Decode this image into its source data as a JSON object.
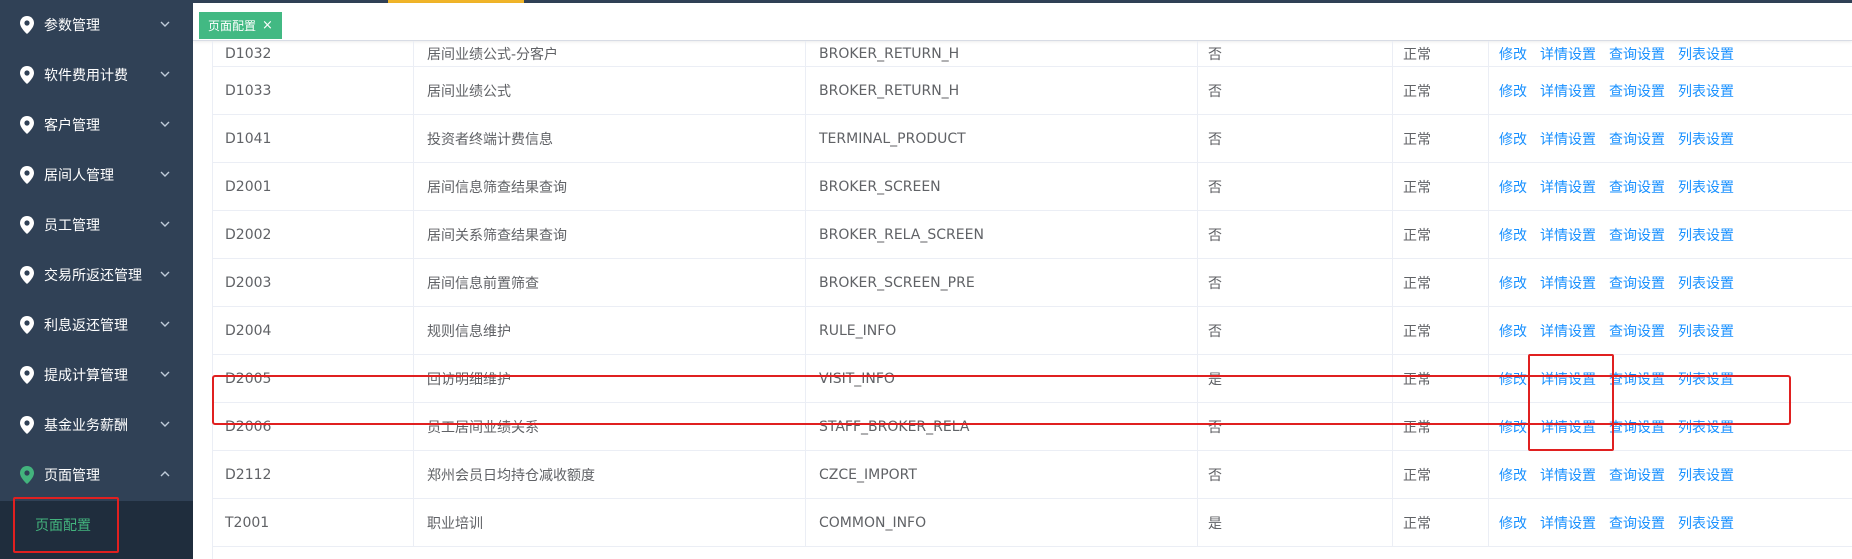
{
  "sidebar": {
    "items": [
      {
        "label": "参数管理"
      },
      {
        "label": "软件费用计费"
      },
      {
        "label": "客户管理"
      },
      {
        "label": "居间人管理"
      },
      {
        "label": "员工管理"
      },
      {
        "label": "交易所返还管理"
      },
      {
        "label": "利息返还管理"
      },
      {
        "label": "提成计算管理"
      },
      {
        "label": "基金业务薪酬"
      },
      {
        "label": "页面管理"
      }
    ],
    "submenu_item": "页面配置"
  },
  "tabs": {
    "active_label": "页面配置",
    "close_glyph": "×"
  },
  "table": {
    "action_labels": {
      "edit": "修改",
      "detail": "详情设置",
      "query": "查询设置",
      "list": "列表设置"
    },
    "rows": [
      [
        "D1032",
        "居间业绩公式-分客户",
        "BROKER_RETURN_H",
        "否",
        "正常"
      ],
      [
        "D1033",
        "居间业绩公式",
        "BROKER_RETURN_H",
        "否",
        "正常"
      ],
      [
        "D1041",
        "投资者终端计费信息",
        "TERMINAL_PRODUCT",
        "否",
        "正常"
      ],
      [
        "D2001",
        "居间信息筛查结果查询",
        "BROKER_SCREEN",
        "否",
        "正常"
      ],
      [
        "D2002",
        "居间关系筛查结果查询",
        "BROKER_RELA_SCREEN",
        "否",
        "正常"
      ],
      [
        "D2003",
        "居间信息前置筛查",
        "BROKER_SCREEN_PRE",
        "否",
        "正常"
      ],
      [
        "D2004",
        "规则信息维护",
        "RULE_INFO",
        "否",
        "正常"
      ],
      [
        "D2005",
        "回访明细维护",
        "VISIT_INFO",
        "是",
        "正常"
      ],
      [
        "D2006",
        "员工居间业绩关系",
        "STAFF_BROKER_RELA",
        "否",
        "正常"
      ],
      [
        "D2112",
        "郑州会员日均持仓减收额度",
        "CZCE_IMPORT",
        "否",
        "正常"
      ],
      [
        "T2001",
        "职业培训",
        "COMMON_INFO",
        "是",
        "正常"
      ]
    ]
  },
  "colors": {
    "sidebar_bg": "#304156",
    "accent_green": "#42b983",
    "link_blue": "#1890ff",
    "highlight_red": "#e02020"
  },
  "icons": {
    "menu": "map-pin-icon",
    "expand": "chevron-down-icon",
    "collapse": "chevron-up-icon"
  }
}
